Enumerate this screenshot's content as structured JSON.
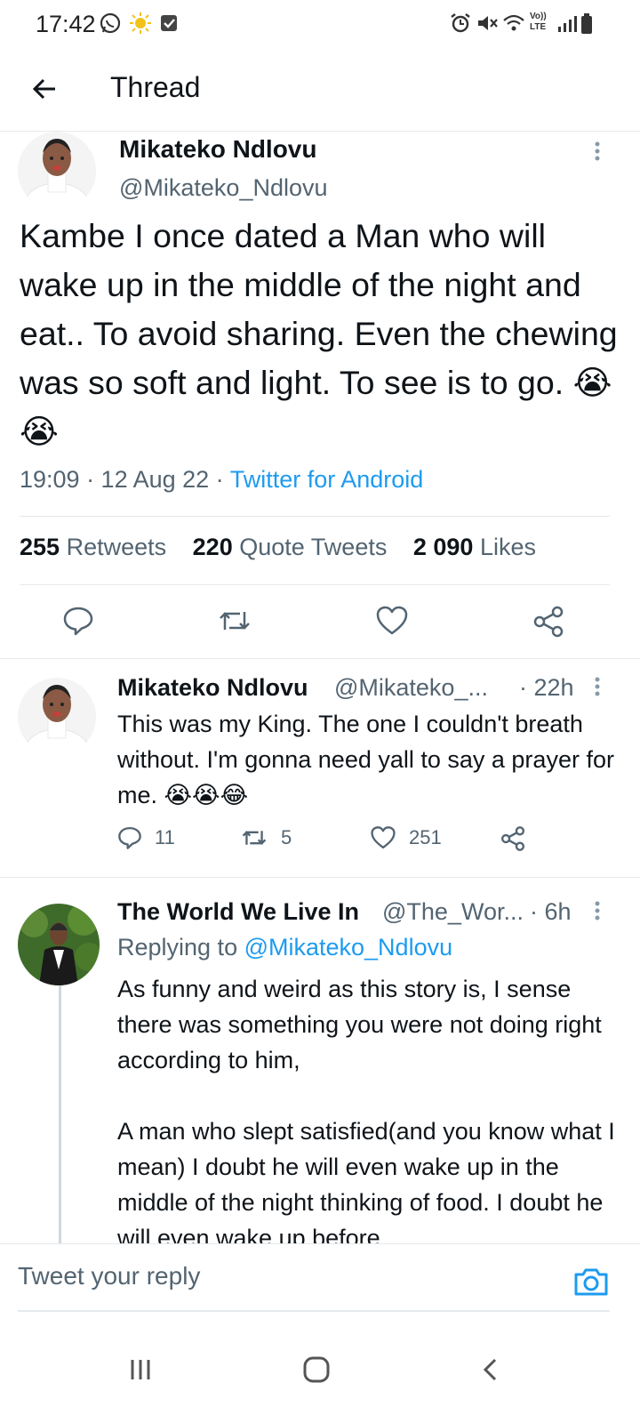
{
  "status_bar": {
    "time": "17:42",
    "left_icons": [
      "whatsapp-icon",
      "sun-icon",
      "checkbox-icon"
    ],
    "right_icons": [
      "alarm-icon",
      "mute-icon",
      "wifi-icon",
      "volte-icon",
      "signal-icon",
      "battery-icon"
    ],
    "volte_label": "Vo)) LTE"
  },
  "header": {
    "title": "Thread"
  },
  "main_tweet": {
    "author_name": "Mikateko Ndlovu",
    "author_handle": "@Mikateko_Ndlovu",
    "text": "Kambe I once dated a Man who will wake up in the middle of the night and eat.. To avoid sharing. Even the chewing was so soft and light. To see is to go. 😭😭",
    "time": "19:09 · 12 Aug 22 · ",
    "source": "Twitter for Android",
    "stats": {
      "retweets_count": "255",
      "retweets_label": "Retweets",
      "quotes_count": "220",
      "quotes_label": "Quote Tweets",
      "likes_count": "2 090",
      "likes_label": "Likes"
    }
  },
  "replies": [
    {
      "author_name": "Mikateko Ndlovu",
      "author_handle": "@Mikateko_...",
      "age": "· 22h",
      "text": "This was my King. The one I couldn't breath without. I'm gonna need yall to say a prayer for me. 😭😭😂",
      "reply_count": "11",
      "retweet_count": "5",
      "like_count": "251"
    },
    {
      "author_name": "The World We Live In",
      "author_handle": "@The_Wor...",
      "age": "· 6h",
      "replying_prefix": "Replying to ",
      "replying_to": "@Mikateko_Ndlovu",
      "text_p1": "As funny and weird as this story is, I sense there was something you were not doing right according to him,",
      "text_p2": "A man who slept satisfied(and you know what I mean) I doubt he will even wake up in the middle of the night thinking of food. I doubt he will even wake up before"
    }
  ],
  "composer": {
    "placeholder": "Tweet your reply"
  },
  "colors": {
    "accent": "#1d9bf0",
    "secondary_text": "#536471",
    "divider": "#e6e9ec"
  }
}
